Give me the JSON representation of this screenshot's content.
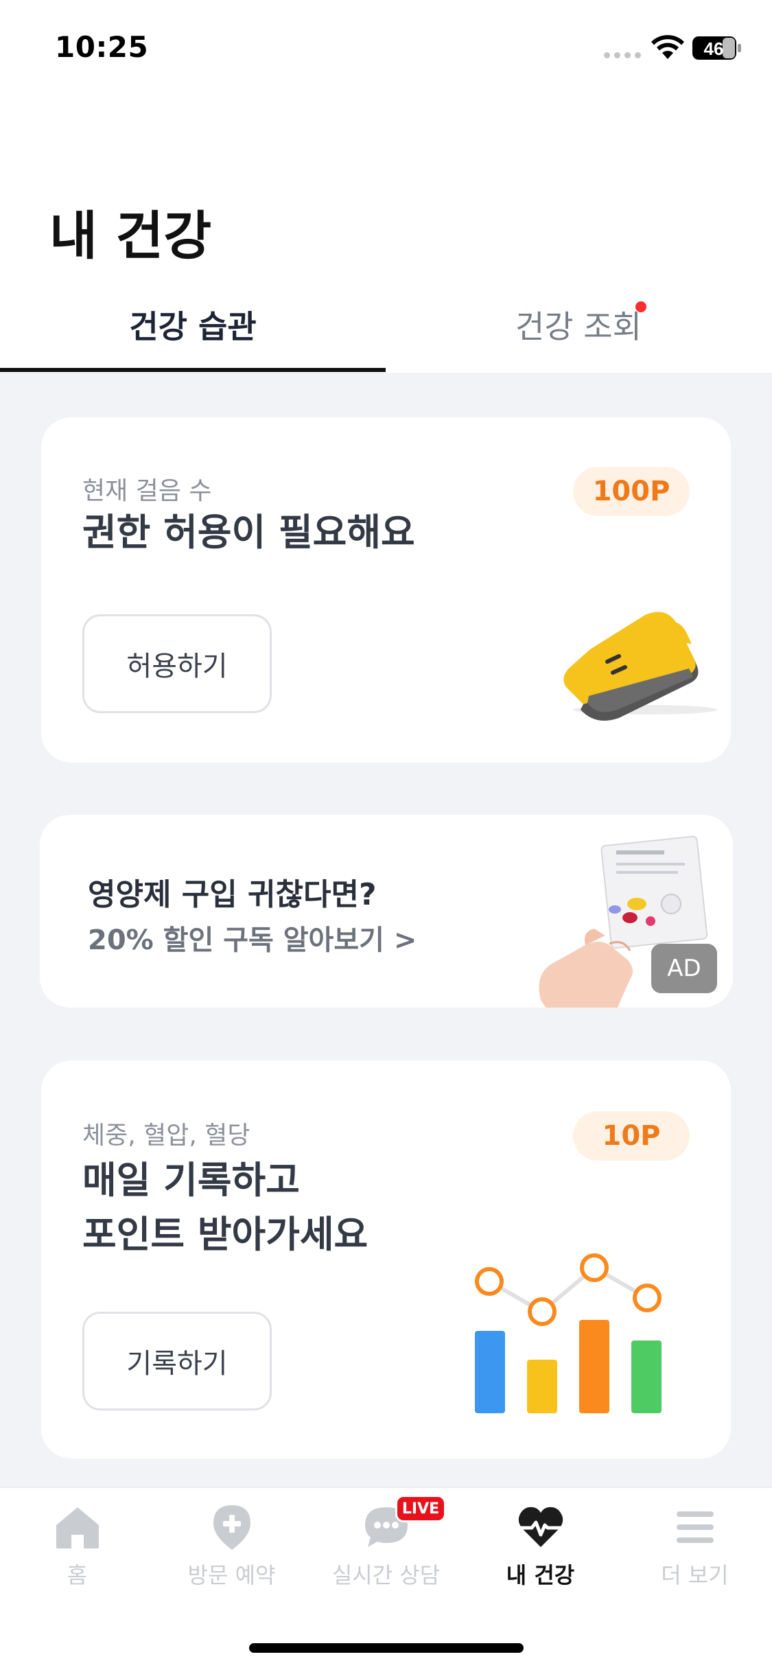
{
  "status_bar": {
    "time": "10:25",
    "battery": "46"
  },
  "page_title": "내 건강",
  "tabs": [
    {
      "label": "건강 습관",
      "active": true
    },
    {
      "label": "건강 조회",
      "active": false,
      "has_new_dot": true
    }
  ],
  "steps_card": {
    "subtitle": "현재 걸음 수",
    "title": "권한 허용이 필요해요",
    "points": "100P",
    "button": "허용하기",
    "illustration": "sneaker-icon"
  },
  "ad_card": {
    "title": "영양제 구입 귀찮다면?",
    "subtitle": "20% 할인 구독 알아보기 >",
    "badge": "AD",
    "illustration": "supplement-pack-hand"
  },
  "record_card": {
    "subtitle": "체중, 혈압, 혈당",
    "title_line1": "매일 기록하고",
    "title_line2": "포인트 받아가세요",
    "points": "10P",
    "button": "기록하기",
    "illustration": "bar-line-chart-icon"
  },
  "bottom_nav": {
    "items": [
      {
        "label": "홈",
        "icon": "home-icon",
        "active": false
      },
      {
        "label": "방문 예약",
        "icon": "location-plus-icon",
        "active": false
      },
      {
        "label": "실시간 상담",
        "icon": "chat-bubble-icon",
        "active": false,
        "badge": "LIVE"
      },
      {
        "label": "내 건강",
        "icon": "heart-pulse-icon",
        "active": true
      },
      {
        "label": "더 보기",
        "icon": "menu-icon",
        "active": false
      }
    ]
  },
  "colors": {
    "accent_orange": "#f07a1a",
    "points_bg": "#fff2e5",
    "live_red": "#e8121c",
    "chart_blue": "#3b97ef",
    "chart_yellow": "#f7c21b",
    "chart_orange": "#fb8a1e",
    "chart_green": "#4fcb63"
  }
}
